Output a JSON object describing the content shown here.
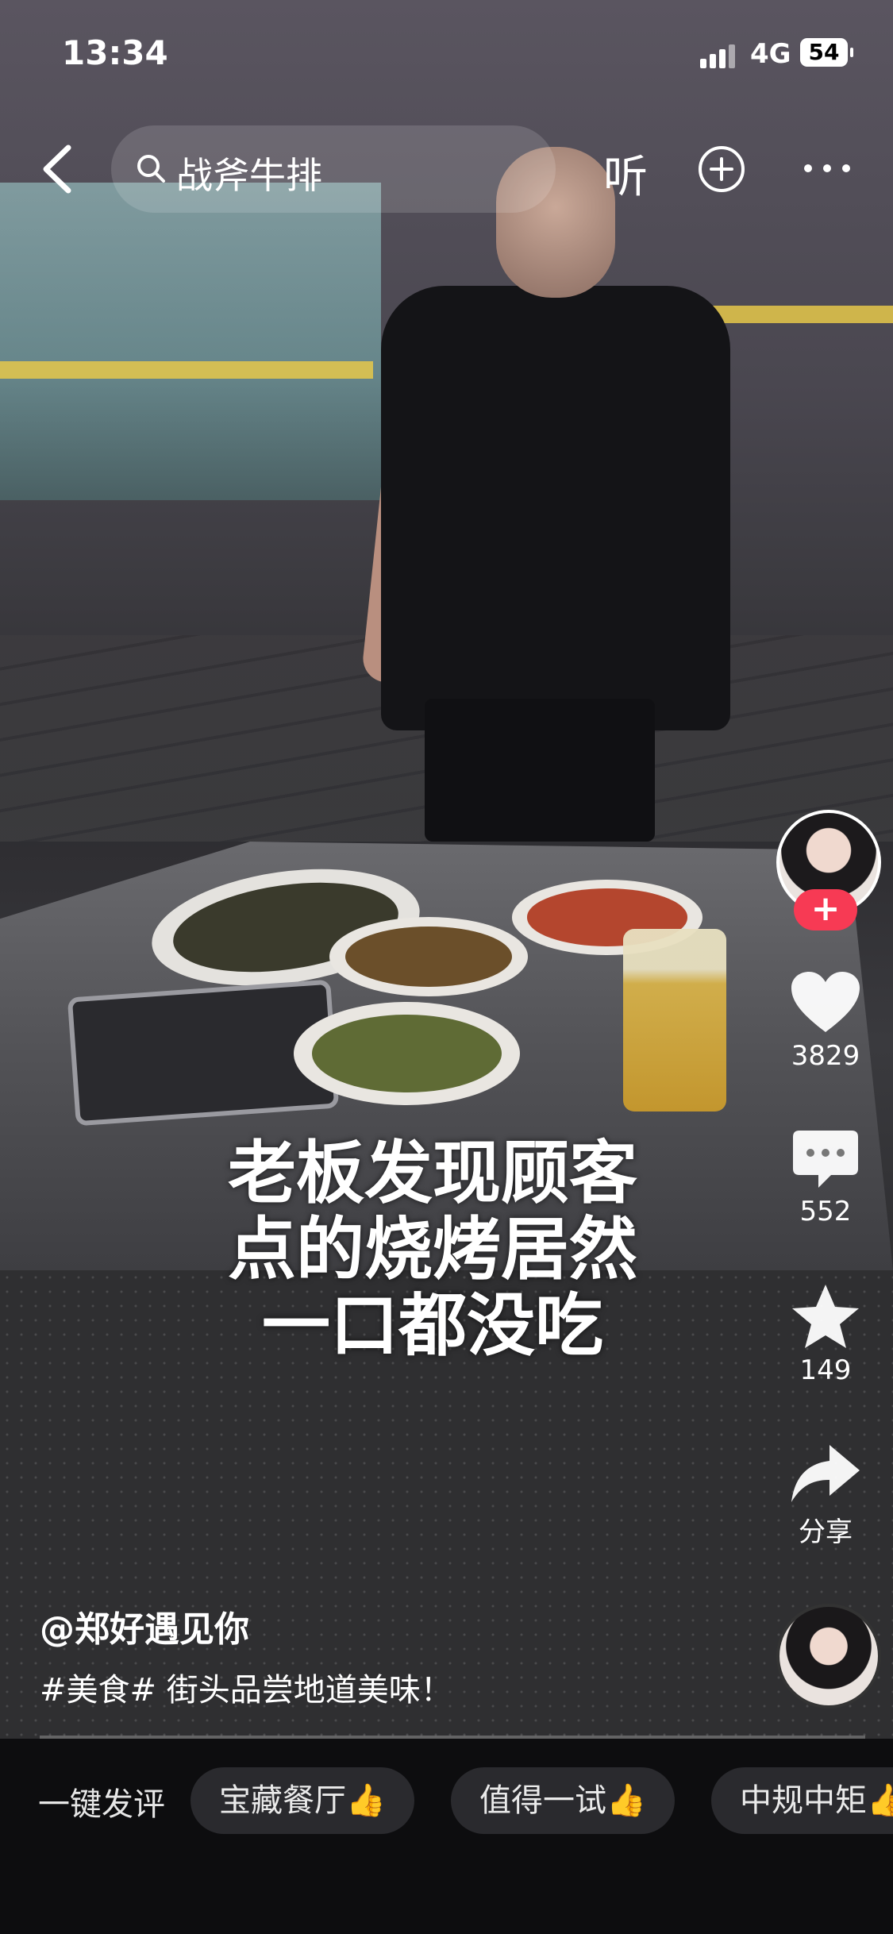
{
  "status_bar": {
    "time": "13:34",
    "network": "4G",
    "battery": "54"
  },
  "top_nav": {
    "search_text": "战斧牛排",
    "listen_label": "听"
  },
  "video": {
    "caption_lines": [
      "老板发现顾客",
      "点的烧烤居然",
      "一口都没吃"
    ]
  },
  "rail": {
    "likes": "3829",
    "comments": "552",
    "favorites": "149",
    "share_label": "分享",
    "follow_symbol": "+"
  },
  "post": {
    "author": "@郑好遇见你",
    "description": "#美食# 街头品尝地道美味！"
  },
  "quick_comments": {
    "label": "一键发评",
    "chips": [
      "宝藏餐厅👍",
      "值得一试👍",
      "中规中矩👍"
    ]
  },
  "icons": [
    "back-icon",
    "search-icon",
    "add-icon",
    "more-icon",
    "heart-icon",
    "comment-icon",
    "star-icon",
    "share-icon"
  ],
  "colors": {
    "follow_red": "#f73a54",
    "bottom_bar": "#0d0d0f",
    "chip_bg": "#2a2a2e"
  }
}
